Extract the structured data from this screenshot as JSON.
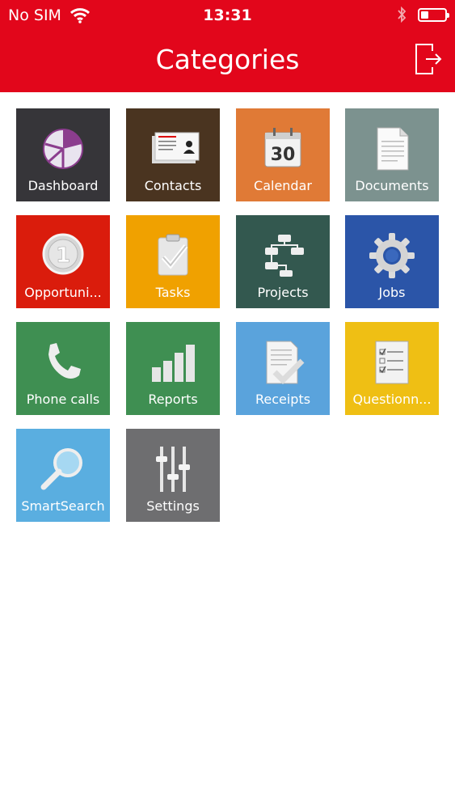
{
  "status_bar": {
    "carrier": "No SIM",
    "time": "13:31",
    "battery_level": 0.3
  },
  "nav": {
    "title": "Categories"
  },
  "colors": {
    "header": "#e2061b",
    "dashboard": "#363539",
    "contacts": "#4a3420",
    "calendar": "#e07a36",
    "documents": "#7c928f",
    "opportunities": "#da1c0c",
    "tasks": "#f0a100",
    "projects": "#33584f",
    "jobs": "#2b55a8",
    "phone_calls": "#3f8f52",
    "reports": "#3f8f52",
    "receipts": "#5aa3dc",
    "questionnaires": "#efbf14",
    "smartsearch": "#5aaee0",
    "settings": "#6e6e70"
  },
  "tiles": [
    {
      "label": "Dashboard",
      "icon": "pie-chart-icon"
    },
    {
      "label": "Contacts",
      "icon": "business-card-icon"
    },
    {
      "label": "Calendar",
      "icon": "calendar-icon",
      "day": "30"
    },
    {
      "label": "Documents",
      "icon": "document-icon"
    },
    {
      "label": "Opportuni...",
      "icon": "coin-icon",
      "coin": "1"
    },
    {
      "label": "Tasks",
      "icon": "clipboard-check-icon"
    },
    {
      "label": "Projects",
      "icon": "flowchart-icon"
    },
    {
      "label": "Jobs",
      "icon": "gear-icon"
    },
    {
      "label": "Phone calls",
      "icon": "phone-icon"
    },
    {
      "label": "Reports",
      "icon": "bar-chart-icon"
    },
    {
      "label": "Receipts",
      "icon": "receipt-check-icon"
    },
    {
      "label": "Questionn...",
      "icon": "checklist-icon"
    },
    {
      "label": "SmartSearch",
      "icon": "magnifier-icon"
    },
    {
      "label": "Settings",
      "icon": "sliders-icon"
    }
  ]
}
